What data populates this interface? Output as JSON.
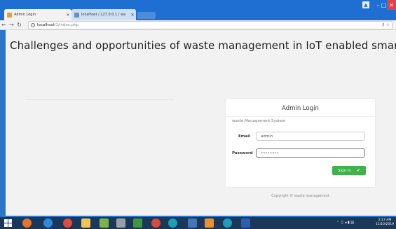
{
  "browser": {
    "tabs": [
      {
        "label": "Admin Login",
        "favicon_color": "#f39c2b"
      },
      {
        "label": "localhost / 127.0.0.1 / wa",
        "favicon_color": "#6d8fb8"
      }
    ],
    "address": {
      "host": "localhost",
      "path": "/1/index.php"
    }
  },
  "page": {
    "headline": "Challenges and opportunities of waste management in IoT enabled smart cities",
    "login": {
      "title": "Admin Login",
      "subtitle": "waste Management System",
      "email_label": "Email",
      "email_value": "admin",
      "password_label": "Password",
      "password_value": "••••••••",
      "signin_label": "Sign In"
    },
    "copyright": "Copyright © waste management"
  },
  "taskbar": {
    "clock_time": "2:17 AM",
    "clock_date": "11/10/2019"
  },
  "colors": {
    "accent_green": "#3fb24a",
    "chrome_blue": "#1f6fd2",
    "close_red": "#e04343"
  }
}
